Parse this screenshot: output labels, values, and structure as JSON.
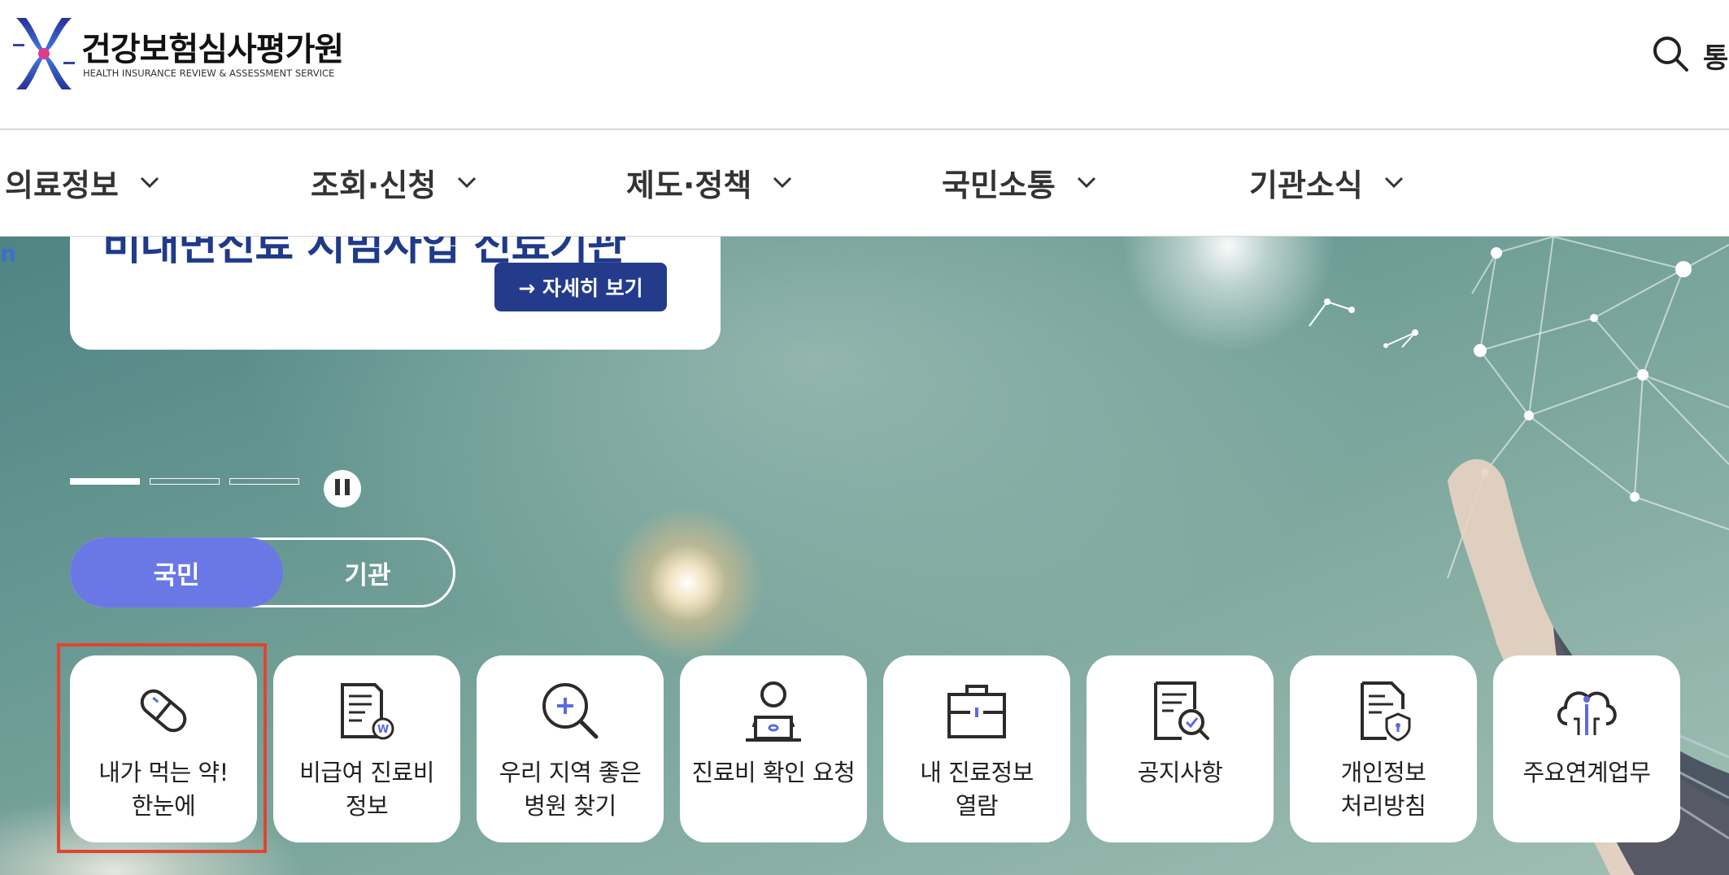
{
  "header": {
    "org_name": "건강보험심사평가원",
    "org_sub": "HEALTH INSURANCE REVIEW & ASSESSMENT SERVICE",
    "search_label": "통"
  },
  "gnb": [
    {
      "label": "의료정보"
    },
    {
      "label": "조회·신청"
    },
    {
      "label": "제도·정책"
    },
    {
      "label": "국민소통"
    },
    {
      "label": "기관소식"
    }
  ],
  "hero": {
    "side_text": "n",
    "banner_title": "비대면진료 시범사업 진료기관",
    "banner_button": "→ 자세히 보기",
    "toggle": {
      "active": "국민",
      "inactive": "기관"
    }
  },
  "quick_menu": [
    {
      "label": "내가 먹는 약!\n한눈에",
      "icon": "pill-icon"
    },
    {
      "label": "비급여 진료비\n정보",
      "icon": "price-document-icon"
    },
    {
      "label": "우리 지역 좋은\n병원 찾기",
      "icon": "magnifier-plus-icon"
    },
    {
      "label": "진료비 확인 요청",
      "icon": "person-laptop-icon"
    },
    {
      "label": "내 진료정보\n열람",
      "icon": "briefcase-icon"
    },
    {
      "label": "공지사항",
      "icon": "notice-document-icon"
    },
    {
      "label": "개인정보\n처리방침",
      "icon": "privacy-shield-document-icon"
    },
    {
      "label": "주요연계업무",
      "icon": "cloud-network-icon"
    }
  ],
  "colors": {
    "accent": "#6a78e6",
    "banner_button": "#243b8c",
    "highlight": "#e0452d",
    "icon_accent": "#5b6be0"
  }
}
